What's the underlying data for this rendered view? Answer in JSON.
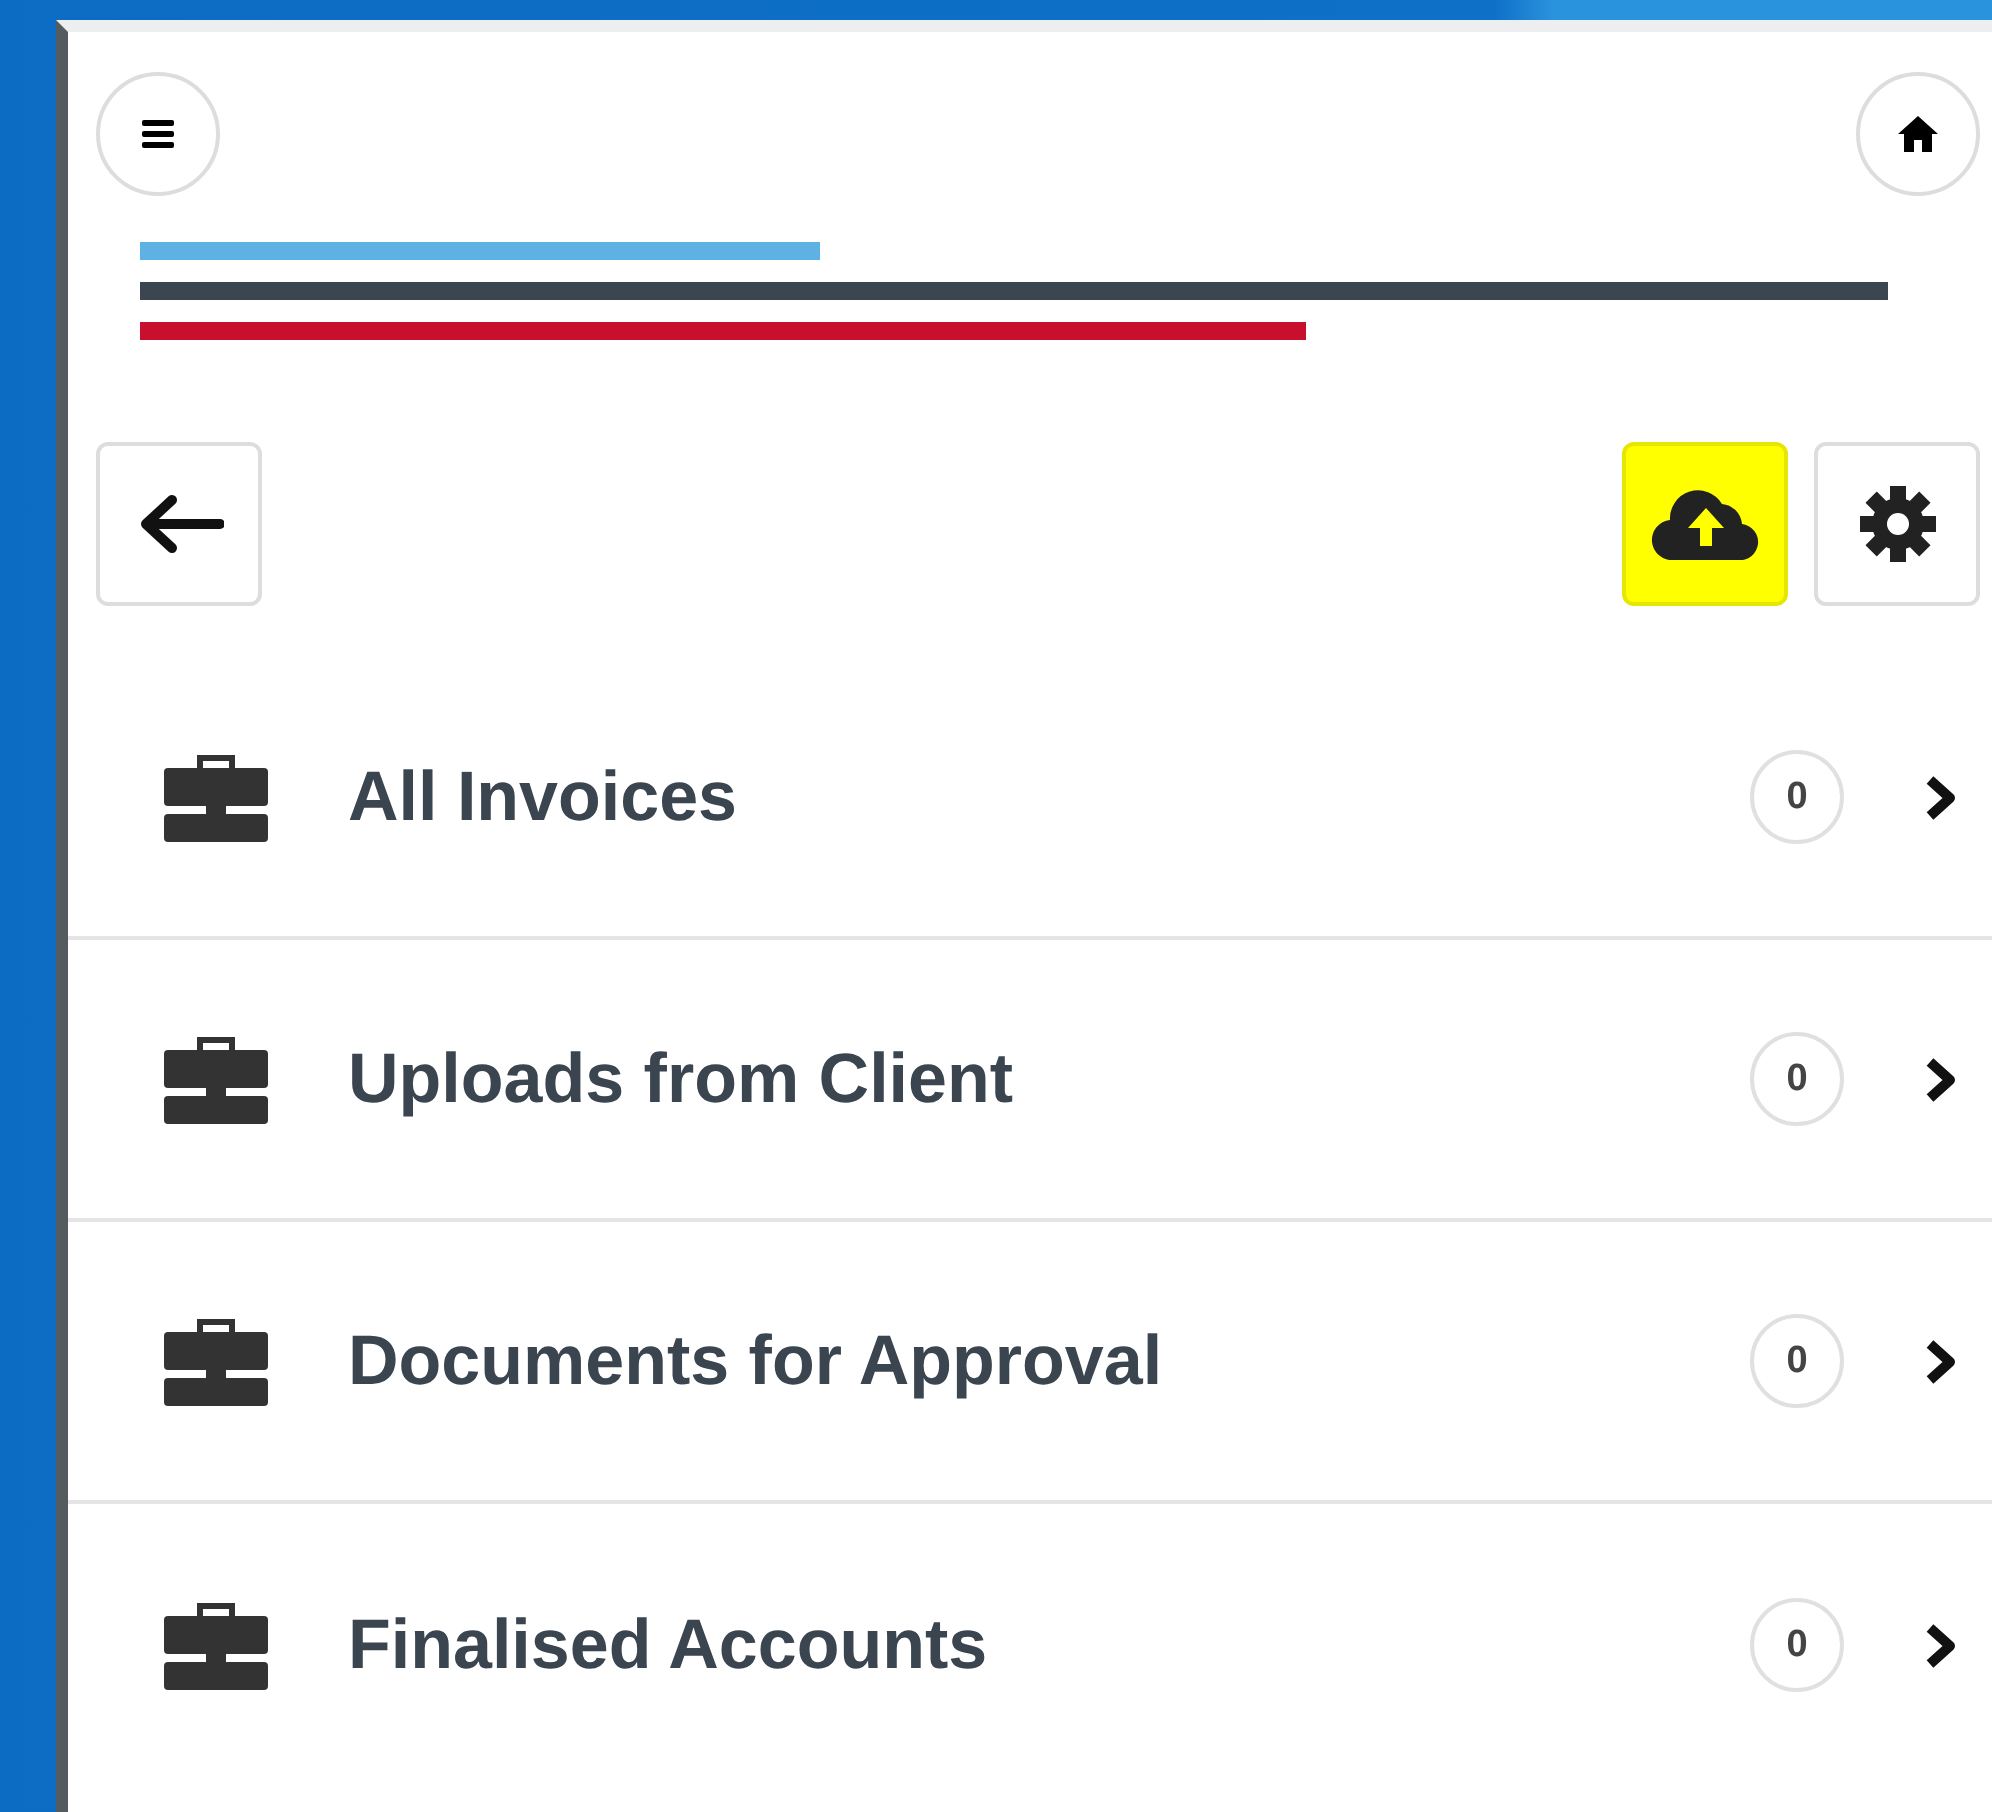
{
  "toolbar": {
    "upload_button": {
      "highlighted": true
    }
  },
  "items": [
    {
      "label": "All Invoices",
      "count": "0"
    },
    {
      "label": "Uploads from Client",
      "count": "0"
    },
    {
      "label": "Documents for Approval",
      "count": "0"
    },
    {
      "label": "Finalised Accounts",
      "count": "0"
    }
  ]
}
